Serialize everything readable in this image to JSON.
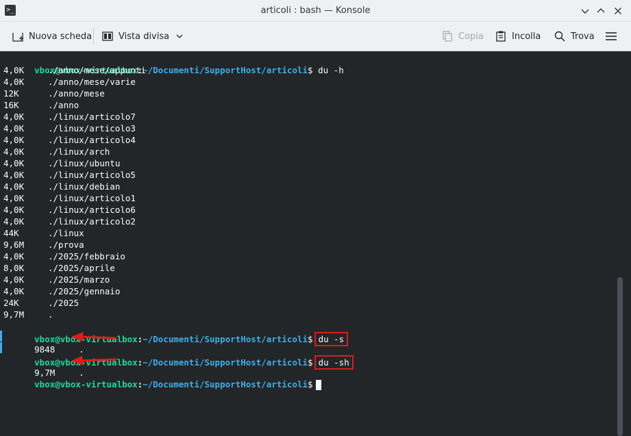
{
  "window": {
    "title": "articoli : bash — Konsole",
    "app_icon_glyph": ">_"
  },
  "toolbar": {
    "new_tab": "Nuova scheda",
    "split_view": "Vista divisa",
    "copy": "Copia",
    "paste": "Incolla",
    "find": "Trova"
  },
  "colors": {
    "prompt_user": "#1cdc9a",
    "prompt_path": "#3daee9",
    "highlight_box": "#e01b1b",
    "background": "#232629"
  },
  "terminal": {
    "prompt": {
      "user": "vbox@vbox-virtualbox",
      "colon": ":",
      "path": "~/Documenti/SupportHost/articoli",
      "symbol": "$"
    },
    "commands": [
      "du -h",
      "du -s",
      "du -sh"
    ],
    "du_h_output": [
      {
        "size": "4,0K",
        "path": "./anno/mese/appunti"
      },
      {
        "size": "4,0K",
        "path": "./anno/mese/varie"
      },
      {
        "size": "12K",
        "path": "./anno/mese"
      },
      {
        "size": "16K",
        "path": "./anno"
      },
      {
        "size": "4,0K",
        "path": "./linux/articolo7"
      },
      {
        "size": "4,0K",
        "path": "./linux/articolo3"
      },
      {
        "size": "4,0K",
        "path": "./linux/articolo4"
      },
      {
        "size": "4,0K",
        "path": "./linux/arch"
      },
      {
        "size": "4,0K",
        "path": "./linux/ubuntu"
      },
      {
        "size": "4,0K",
        "path": "./linux/articolo5"
      },
      {
        "size": "4,0K",
        "path": "./linux/debian"
      },
      {
        "size": "4,0K",
        "path": "./linux/articolo1"
      },
      {
        "size": "4,0K",
        "path": "./linux/articolo6"
      },
      {
        "size": "4,0K",
        "path": "./linux/articolo2"
      },
      {
        "size": "44K",
        "path": "./linux"
      },
      {
        "size": "9,6M",
        "path": "./prova"
      },
      {
        "size": "4,0K",
        "path": "./2025/febbraio"
      },
      {
        "size": "8,0K",
        "path": "./2025/aprile"
      },
      {
        "size": "4,0K",
        "path": "./2025/marzo"
      },
      {
        "size": "4,0K",
        "path": "./2025/gennaio"
      },
      {
        "size": "24K",
        "path": "./2025"
      },
      {
        "size": "9,7M",
        "path": "."
      }
    ],
    "du_s_output": {
      "size": "9848",
      "path": "."
    },
    "du_sh_output": {
      "size": "9,7M",
      "path": "."
    }
  }
}
